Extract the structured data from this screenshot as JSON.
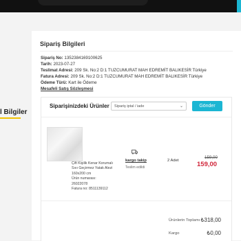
{
  "sidebar": {
    "label": "l Bilgiler"
  },
  "order": {
    "section_title": "Sipariş Bilgileri",
    "no_label": "Sipariş No:",
    "no_value": "1352384169100625",
    "date_label": "Tarih:",
    "date_value": "2023-07-27",
    "delivery_label": "Teslimat Adresi:",
    "delivery_value": "209 Sk. No:2 D:1 TUZCUMURAT MAH EDREMİT BALIKESİR Türkiye",
    "invoice_label": "Fatura Adresi:",
    "invoice_value": "209 Sk. No:2 D:1 TUZCUMURAT MAH EDREMİT BALIKESİR Türkiye",
    "payment_label": "Ödeme Türü:",
    "payment_value": "Kart ile Ödeme",
    "contract_link": "Mesafeli Satış Sözleşmesi"
  },
  "products": {
    "title": "Siparişinizdeki Ürünler",
    "select_value": "Sipariş iptal / iade",
    "send_button": "Gönder",
    "item": {
      "desc": [
        "Çift Kişilik Kenar Korumalı",
        "Sıvı Geçirmez Yatak Alezi",
        "160x200 cm",
        "Ürün numarası:",
        "26022078",
        "Fatura no: 8511139112"
      ],
      "cargo_link": "kargo takip",
      "status": "Teslim edildi",
      "qty": "2 Adet",
      "old_price": "159,00",
      "new_price": "159,00"
    }
  },
  "summary": {
    "products_total_label": "Ürünlerin Toplamı",
    "products_total_value": "₺318,00",
    "cargo_label": "Kargo",
    "cargo_value": "₺0,00"
  },
  "colors": {
    "accent": "#1bb6d3",
    "price": "#d0263a",
    "underline": "#f2c200"
  },
  "icons": [
    "chevron-down-icon",
    "cargo-box-icon"
  ]
}
